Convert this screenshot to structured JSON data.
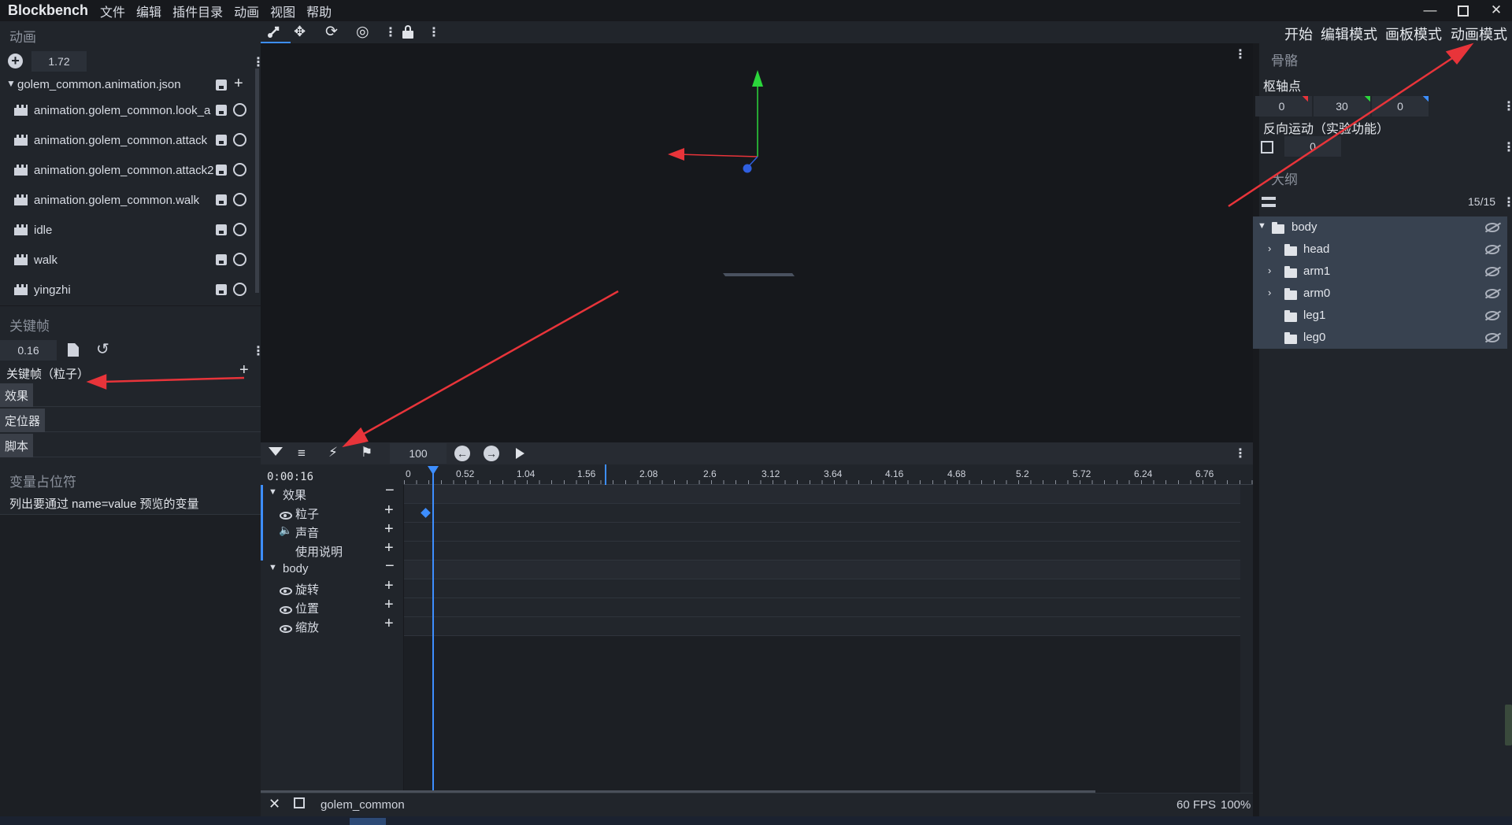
{
  "app": {
    "brand": "Blockbench",
    "menu": [
      "文件",
      "编辑",
      "插件目录",
      "动画",
      "视图",
      "帮助"
    ],
    "window_controls": [
      "minimize",
      "maximize",
      "close"
    ]
  },
  "modes": [
    "开始",
    "编辑模式",
    "画板模式",
    "动画模式"
  ],
  "active_mode": "动画模式",
  "left": {
    "animations_title": "动画",
    "anim_length": "1.72",
    "file_name": "golem_common.animation.json",
    "animations": [
      "animation.golem_common.look_a",
      "animation.golem_common.attack",
      "animation.golem_common.attack2",
      "animation.golem_common.walk",
      "idle",
      "walk",
      "yingzhi"
    ],
    "keyframe_title": "关键帧",
    "keyframe_time": "0.16",
    "keyframe_channel": "关键帧（粒子）",
    "tags": [
      "效果",
      "定位器",
      "脚本"
    ],
    "placeholder_title": "变量占位符",
    "placeholder_desc": "列出要通过 name=value 预览的变量"
  },
  "timeline": {
    "zoom": "100",
    "time": "0:00:16",
    "ticks": [
      "0",
      "0.52",
      "1.04",
      "1.56",
      "2.08",
      "2.6",
      "3.12",
      "3.64",
      "4.16",
      "4.68",
      "5.2",
      "5.72",
      "6.24",
      "6.76"
    ],
    "groups": [
      {
        "name": "效果",
        "channels": [
          "粒子",
          "声音",
          "使用说明"
        ]
      },
      {
        "name": "body",
        "channels": [
          "旋转",
          "位置",
          "缩放"
        ]
      }
    ]
  },
  "right": {
    "bone_title": "骨骼",
    "pivot_title": "枢轴点",
    "pivot": [
      "0",
      "30",
      "0"
    ],
    "ik_title": "反向运动（实验功能）",
    "ik_value": "0",
    "outliner_title": "大纲",
    "outliner_count": "15/15",
    "outliner": [
      {
        "name": "body",
        "depth": 0,
        "expanded": true
      },
      {
        "name": "head",
        "depth": 1,
        "expandable": true
      },
      {
        "name": "arm1",
        "depth": 1,
        "expandable": true
      },
      {
        "name": "arm0",
        "depth": 1,
        "expandable": true
      },
      {
        "name": "leg1",
        "depth": 1,
        "expandable": false
      },
      {
        "name": "leg0",
        "depth": 1,
        "expandable": false
      }
    ]
  },
  "status": {
    "model": "golem_common",
    "fps": "60 FPS",
    "zoom": "100%"
  },
  "colors": {
    "accent": "#3d8eff",
    "arrow": "#e8343a",
    "axis_x": "#e8343a",
    "axis_y": "#2bd63b",
    "axis_z": "#2f5fe0"
  }
}
